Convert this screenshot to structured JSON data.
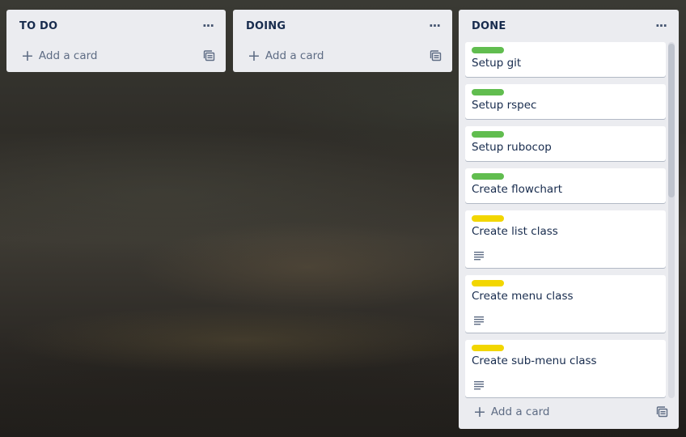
{
  "lists": [
    {
      "title": "TO DO",
      "add_label": "Add a card"
    },
    {
      "title": "DOING",
      "add_label": "Add a card"
    },
    {
      "title": "DONE",
      "add_label": "Add a card",
      "cards": [
        {
          "title": "Setup git",
          "label_color": "#61bd4f",
          "has_description": false
        },
        {
          "title": "Setup rspec",
          "label_color": "#61bd4f",
          "has_description": false
        },
        {
          "title": "Setup rubocop",
          "label_color": "#61bd4f",
          "has_description": false
        },
        {
          "title": "Create flowchart",
          "label_color": "#61bd4f",
          "has_description": false
        },
        {
          "title": "Create list class",
          "label_color": "#f2d600",
          "has_description": true
        },
        {
          "title": "Create menu class",
          "label_color": "#f2d600",
          "has_description": true
        },
        {
          "title": "Create sub-menu class",
          "label_color": "#f2d600",
          "has_description": true
        }
      ]
    }
  ],
  "icons": {
    "menu": "ellipsis-icon",
    "add": "plus-icon",
    "template": "card-template-icon",
    "description": "description-icon"
  },
  "colors": {
    "list_bg": "#ebecf0",
    "title_text": "#172b4d",
    "muted_text": "#5e6c84",
    "label_green": "#61bd4f",
    "label_yellow": "#f2d600"
  }
}
